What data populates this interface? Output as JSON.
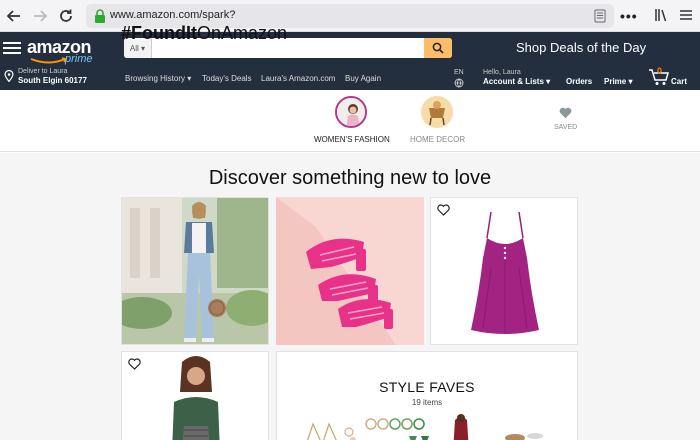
{
  "browser": {
    "url": "www.amazon.com/spark?"
  },
  "header": {
    "logo_text": "amazon",
    "logo_sub": "prime",
    "search_dept": "All",
    "search_value": "",
    "shop_deals": "Shop Deals of the Day",
    "deliver_line1": "Deliver to Laura",
    "deliver_line2": "South Elgin 60177",
    "subnav": [
      "Browsing History",
      "Today's Deals",
      "Laura's Amazon.com",
      "Buy Again"
    ],
    "lang": "EN",
    "account_line1": "Hello, Laura",
    "account_line2": "Account & Lists",
    "orders": "Orders",
    "prime": "Prime",
    "cart_count": "0",
    "cart_label": "Cart"
  },
  "spark": {
    "title_bold": "#FoundIt",
    "title_rest": "OnAmazon",
    "categories": [
      {
        "label": "WOMEN'S FASHION",
        "active": true
      },
      {
        "label": "HOME DECOR",
        "active": false
      }
    ],
    "saved_label": "SAVED"
  },
  "feed": {
    "heading": "Discover something new to love",
    "style_faves": {
      "title": "STYLE FAVES",
      "count": "19 items"
    }
  },
  "colors": {
    "amazon_dark": "#232f3e",
    "search_orange": "#febd69",
    "prime_blue": "#7dc2f0",
    "cart_orange": "#f08804",
    "active_ring": "#b03a8e"
  }
}
